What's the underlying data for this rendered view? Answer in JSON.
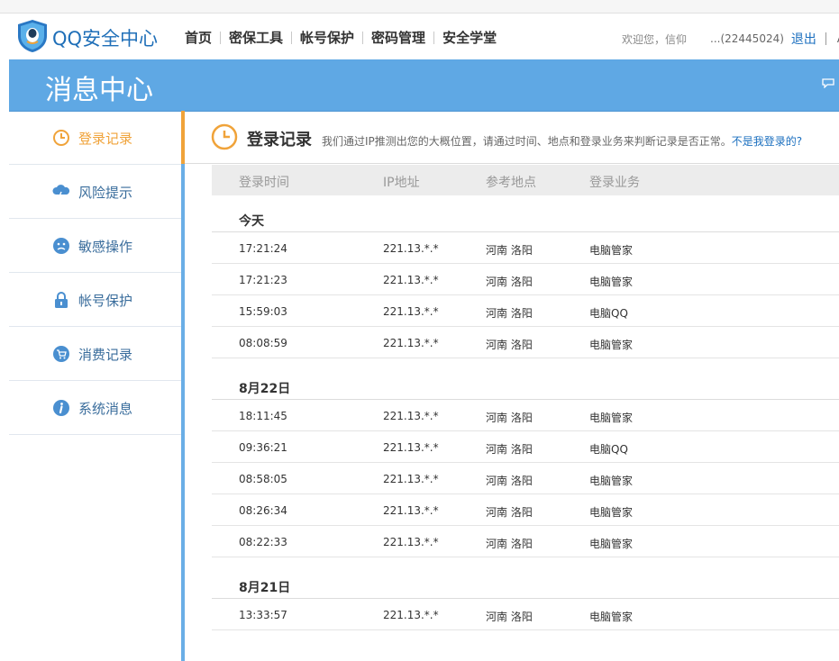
{
  "header": {
    "brand": "QQ安全中心",
    "nav": [
      "首页",
      "密保工具",
      "帐号保护",
      "密码管理",
      "安全学堂"
    ],
    "welcome": "欢迎您，信仰",
    "uid": "...(22445024)",
    "logout": "退出",
    "more": "A"
  },
  "banner": {
    "title": "消息中心"
  },
  "sidebar": {
    "items": [
      {
        "label": "登录记录",
        "icon": "clock-icon",
        "active": true
      },
      {
        "label": "风险提示",
        "icon": "cloud-lightning-icon"
      },
      {
        "label": "敏感操作",
        "icon": "smiley-icon"
      },
      {
        "label": "帐号保护",
        "icon": "lock-icon"
      },
      {
        "label": "消费记录",
        "icon": "cart-icon"
      },
      {
        "label": "系统消息",
        "icon": "info-icon"
      }
    ]
  },
  "main": {
    "title": "登录记录",
    "description": "我们通过IP推测出您的大概位置，请通过时间、地点和登录业务来判断记录是否正常。",
    "not_me": "不是我登录的?",
    "columns": [
      "登录时间",
      "IP地址",
      "参考地点",
      "登录业务"
    ],
    "groups": [
      {
        "date": "今天",
        "rows": [
          [
            "17:21:24",
            "221.13.*.*",
            "河南 洛阳",
            "电脑管家"
          ],
          [
            "17:21:23",
            "221.13.*.*",
            "河南 洛阳",
            "电脑管家"
          ],
          [
            "15:59:03",
            "221.13.*.*",
            "河南 洛阳",
            "电脑QQ"
          ],
          [
            "08:08:59",
            "221.13.*.*",
            "河南 洛阳",
            "电脑管家"
          ]
        ]
      },
      {
        "date": "8月22日",
        "rows": [
          [
            "18:11:45",
            "221.13.*.*",
            "河南 洛阳",
            "电脑管家"
          ],
          [
            "09:36:21",
            "221.13.*.*",
            "河南 洛阳",
            "电脑QQ"
          ],
          [
            "08:58:05",
            "221.13.*.*",
            "河南 洛阳",
            "电脑管家"
          ],
          [
            "08:26:34",
            "221.13.*.*",
            "河南 洛阳",
            "电脑管家"
          ],
          [
            "08:22:33",
            "221.13.*.*",
            "河南 洛阳",
            "电脑管家"
          ]
        ]
      },
      {
        "date": "8月21日",
        "rows": [
          [
            "13:33:57",
            "221.13.*.*",
            "河南 洛阳",
            "电脑管家"
          ]
        ]
      }
    ]
  },
  "colors": {
    "banner": "#5fa8e4",
    "accent": "#f0a33a",
    "link": "#1b6fbf",
    "sidebar_text": "#3a6d9c"
  }
}
